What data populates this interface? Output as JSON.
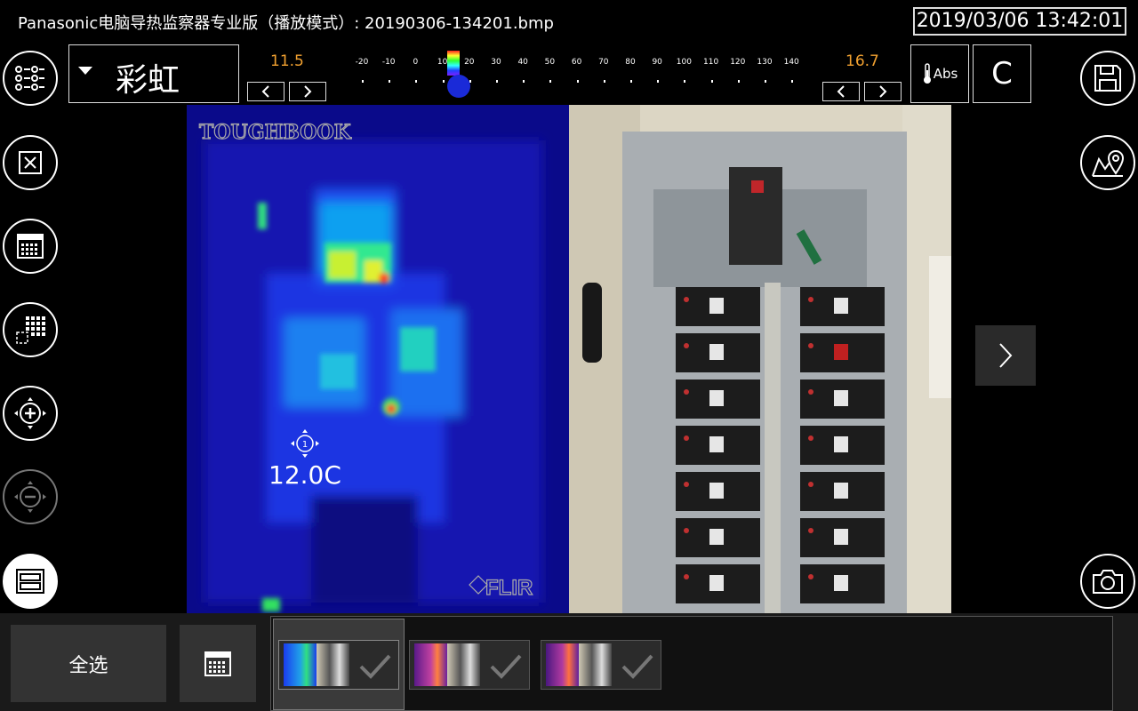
{
  "titlebar": {
    "title": "Panasonic电脑导热监察器专业版（播放模式）: 20190306-134201.bmp",
    "datetime": "2019/03/06 13:42:01"
  },
  "toolbar": {
    "palette_label": "彩虹",
    "range_min": "11.5",
    "range_max": "16.7",
    "scale_ticks": [
      "-20",
      "-10",
      "0",
      "10",
      "20",
      "30",
      "40",
      "50",
      "60",
      "70",
      "80",
      "90",
      "100",
      "110",
      "120",
      "130",
      "140"
    ],
    "slider_value": 11.5,
    "abs_label": "Abs",
    "unit_label": "C"
  },
  "left_toolbar": {
    "items": [
      "list-settings-icon",
      "close-icon",
      "calendar-icon",
      "grid-select-icon",
      "zoom-in-icon",
      "zoom-out-icon",
      "view-layout-icon"
    ]
  },
  "right_toolbar": {
    "items": [
      "save-icon",
      "map-location-icon",
      "camera-icon"
    ]
  },
  "thermal_view": {
    "watermark_top": "TOUGHBOOK",
    "watermark_bottom": "FLIR",
    "spot_number": "1",
    "spot_temp": "12.0C"
  },
  "bottom_bar": {
    "select_all_label": "全选",
    "thumbnails": [
      {
        "palette": "rainbow",
        "selected": true
      },
      {
        "palette": "iron",
        "selected": false
      },
      {
        "palette": "iron",
        "selected": false
      }
    ]
  },
  "colors": {
    "accent_orange": "#f0a030",
    "slider_blue": "#1a2ad8"
  }
}
